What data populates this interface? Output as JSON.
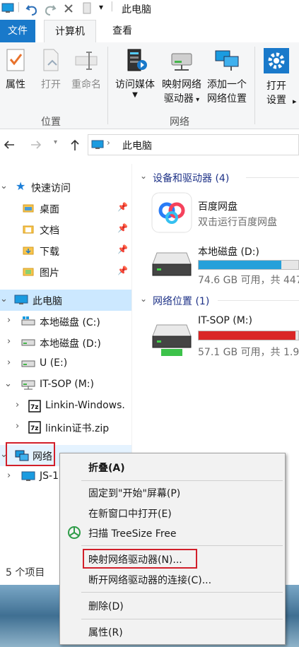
{
  "title_bar": {
    "title": "此电脑",
    "quick_access_dropdown": "▾"
  },
  "ribbon_tabs": {
    "file": "文件",
    "computer": "计算机",
    "view": "查看"
  },
  "ribbon": {
    "location_group": "位置",
    "network_group": "网络",
    "properties": "属性",
    "open": "打开",
    "rename": "重命名",
    "access_media": "访问媒体",
    "map_drive_line1": "映射网络",
    "map_drive_line2": "驱动器",
    "add_location_line1": "添加一个",
    "add_location_line2": "网络位置",
    "open_settings_line1": "打开",
    "open_settings_line2": "设置"
  },
  "address_bar": {
    "path": "此电脑"
  },
  "nav": {
    "quick_access": "快速访问",
    "desktop": "桌面",
    "documents": "文档",
    "downloads": "下载",
    "pictures": "图片",
    "this_pc": "此电脑",
    "drive_c": "本地磁盘 (C:)",
    "drive_d": "本地磁盘 (D:)",
    "drive_e": "U (E:)",
    "drive_m": "IT-SOP (M:)",
    "file1": "Linkin-Windows.",
    "file2": "linkin证书.zip",
    "network": "网络",
    "network_child": "JS-1"
  },
  "content": {
    "devices_header": "设备和驱动器 (4)",
    "network_header": "网络位置 (1)",
    "baidu_name": "百度网盘",
    "baidu_sub": "双击运行百度网盘",
    "drive_d_name": "本地磁盘 (D:)",
    "drive_d_space": "74.6 GB 可用，共 447",
    "drive_d_fill": 0.83,
    "drive_m_name": "IT-SOP (M:)",
    "drive_m_space": "57.1 GB 可用，共 1.9",
    "drive_m_fill": 0.97
  },
  "status_bar": {
    "item_count": "5 个项目"
  },
  "context_menu": {
    "collapse": "折叠(A)",
    "pin_start": "固定到\"开始\"屏幕(P)",
    "open_new_window": "在新窗口中打开(E)",
    "scan_treesize": "扫描 TreeSize Free",
    "map_drive": "映射网络驱动器(N)...",
    "disconnect_drive": "断开网络驱动器的连接(C)...",
    "delete": "删除(D)",
    "properties": "属性(R)"
  },
  "colors": {
    "accent": "#1979ca",
    "selection": "#cce8ff",
    "bar_normal": "#26a0da",
    "bar_full": "#da2626",
    "highlight_box": "#d21f2a"
  }
}
